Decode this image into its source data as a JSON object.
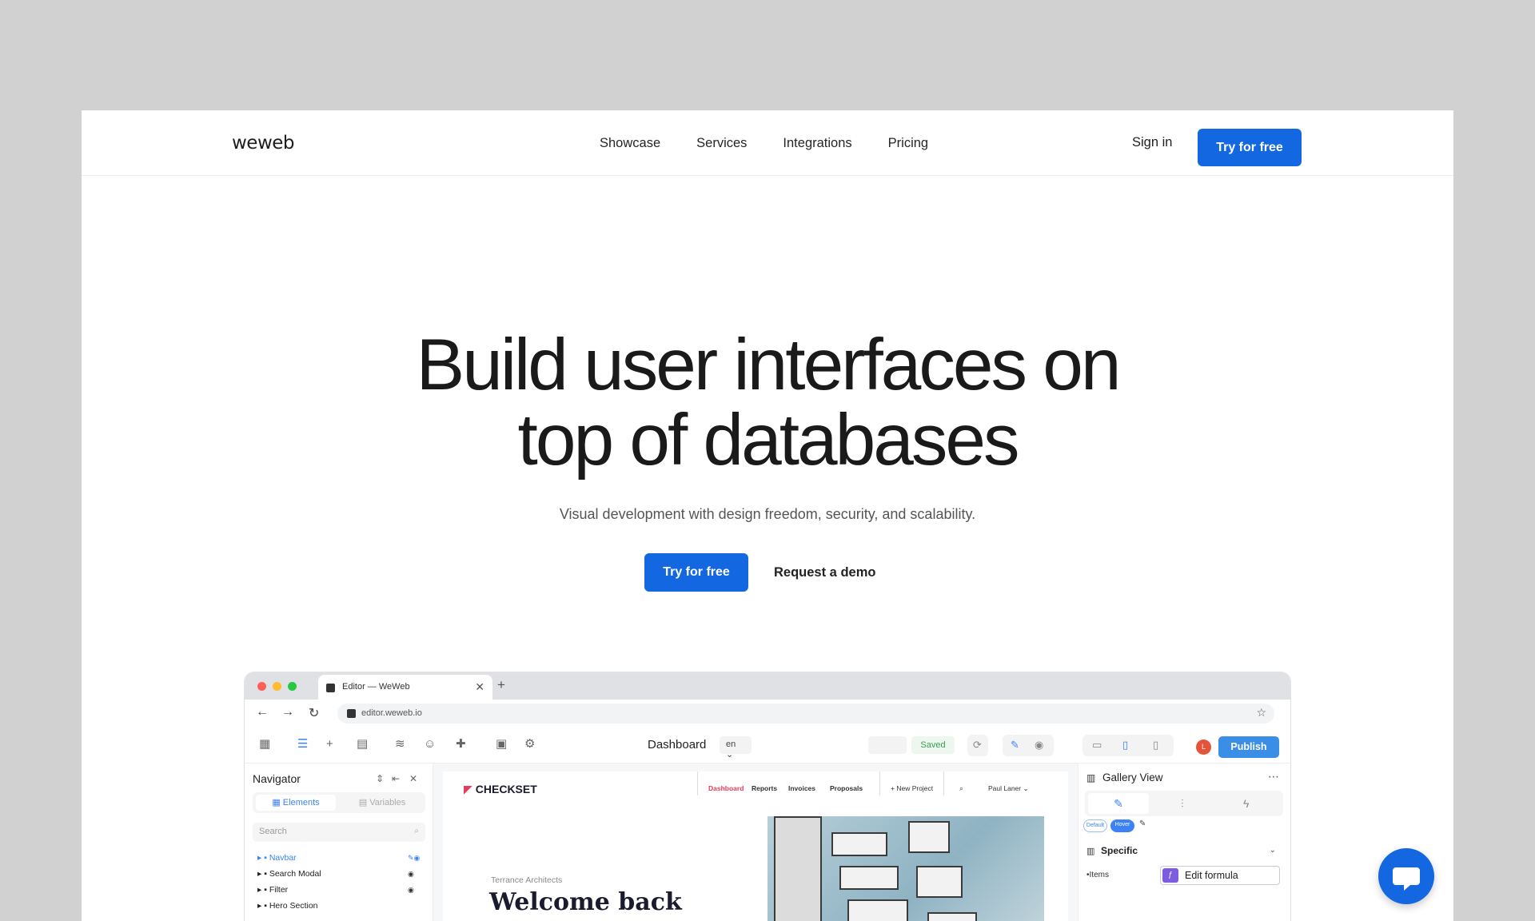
{
  "header": {
    "logo": "weweb",
    "nav": [
      "Showcase",
      "Services",
      "Integrations",
      "Pricing"
    ],
    "sign_in": "Sign in",
    "cta": "Try for free"
  },
  "hero": {
    "title_line1": "Build user interfaces on",
    "title_line2": "top of databases",
    "subtitle": "Visual development with design freedom, security, and scalability.",
    "cta_primary": "Try for free",
    "cta_secondary": "Request a demo"
  },
  "mockup": {
    "tab_title": "Editor — WeWeb",
    "url": "editor.weweb.io",
    "page_title": "Dashboard",
    "lang": "en",
    "saved": "Saved",
    "avatar_initial": "L",
    "publish": "Publish",
    "navigator": {
      "title": "Navigator",
      "tab_elements": "Elements",
      "tab_variables": "Variables",
      "search_placeholder": "Search",
      "items": [
        "Navbar",
        "Search Modal",
        "Filter",
        "Hero Section"
      ]
    },
    "app": {
      "logo": "CHECKSET",
      "nav": [
        "Dashboard",
        "Reports",
        "Invoices",
        "Proposals"
      ],
      "new_project": "+ New Project",
      "user": "Paul Laner",
      "kicker": "Terrance Architects",
      "welcome": "Welcome back"
    },
    "panel": {
      "title": "Gallery View",
      "state_default": "Default",
      "state_hover": "Hover",
      "section": "Specific",
      "items_label": "Items",
      "formula": "Edit formula"
    }
  },
  "colors": {
    "primary": "#1367e0",
    "publish": "#3a8ee6",
    "accent_pink": "#e63b5a",
    "saved_green": "#3a9e4f"
  },
  "icons": [
    "chat-bubble-icon",
    "search-icon",
    "eye-icon",
    "pencil-icon",
    "gear-icon"
  ]
}
